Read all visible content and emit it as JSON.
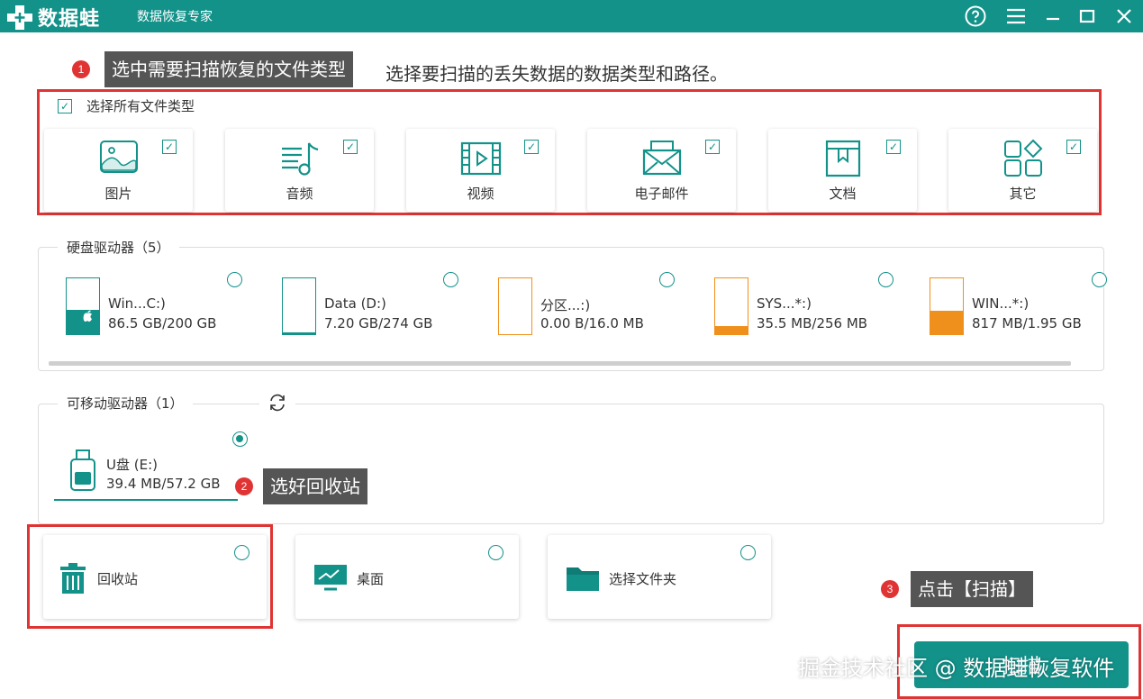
{
  "app": {
    "logo_text": "数据蛙",
    "subtitle": "数据恢复专家",
    "colors": {
      "primary": "#13928a",
      "accent_red": "#e03434",
      "orange": "#f0901c"
    }
  },
  "steps": {
    "step1_number": "1",
    "step1_tip": "选中需要扫描恢复的文件类型",
    "step2_number": "2",
    "step2_tip": "选好回收站",
    "step3_number": "3",
    "step3_tip": "点击【扫描】"
  },
  "instruction": "选择要扫描的丢失数据的数据类型和路径。",
  "file_types": {
    "select_all_label": "选择所有文件类型",
    "select_all_checked": true,
    "items": [
      {
        "label": "图片",
        "icon": "image-icon",
        "checked": true
      },
      {
        "label": "音频",
        "icon": "music-icon",
        "checked": true
      },
      {
        "label": "视频",
        "icon": "video-icon",
        "checked": true
      },
      {
        "label": "电子邮件",
        "icon": "mail-icon",
        "checked": true
      },
      {
        "label": "文档",
        "icon": "document-icon",
        "checked": true
      },
      {
        "label": "其它",
        "icon": "other-icon",
        "checked": true
      }
    ]
  },
  "hard_drives": {
    "title": "硬盘驱动器（5）",
    "items": [
      {
        "name": "Win...C:)",
        "size": "86.5 GB/200 GB",
        "used_fraction": 0.43,
        "fill_color": "#13928a",
        "selected": false
      },
      {
        "name": "Data (D:)",
        "size": "7.20 GB/274 GB",
        "used_fraction": 0.026,
        "fill_color": "#13928a",
        "selected": false
      },
      {
        "name": "分区...:)",
        "size": "0.00  B/16.0 MB",
        "used_fraction": 0.0,
        "fill_color": "#f0901c",
        "selected": false
      },
      {
        "name": "SYS...*:)",
        "size": "35.5 MB/256 MB",
        "used_fraction": 0.14,
        "fill_color": "#f0901c",
        "selected": false
      },
      {
        "name": "WIN...*:)",
        "size": "817 MB/1.95 GB",
        "used_fraction": 0.42,
        "fill_color": "#f0901c",
        "selected": false
      }
    ]
  },
  "removable": {
    "title": "可移动驱动器（1）",
    "refresh_icon": "refresh-icon",
    "items": [
      {
        "name": "U盘 (E:)",
        "size": "39.4 MB/57.2 GB",
        "selected": true
      }
    ]
  },
  "locations": [
    {
      "label": "回收站",
      "icon": "trash-icon",
      "selected": false
    },
    {
      "label": "桌面",
      "icon": "desktop-icon",
      "selected": false
    },
    {
      "label": "选择文件夹",
      "icon": "folder-icon",
      "selected": false
    }
  ],
  "scan_button_label": "扫描",
  "watermark": "掘金技术社区 @ 数据蛙恢复软件"
}
